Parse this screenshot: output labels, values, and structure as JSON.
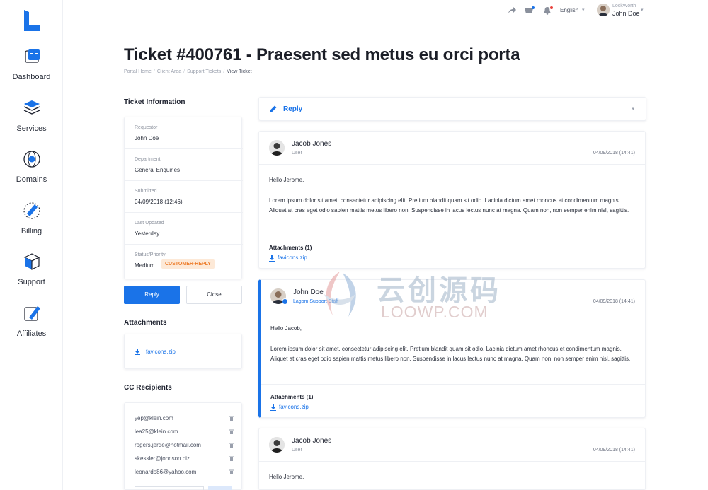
{
  "nav": {
    "items": [
      {
        "label": "Dashboard",
        "icon": "dashboard-icon"
      },
      {
        "label": "Services",
        "icon": "services-box-icon"
      },
      {
        "label": "Domains",
        "icon": "globe-icon"
      },
      {
        "label": "Billing",
        "icon": "billing-icon"
      },
      {
        "label": "Support",
        "icon": "support-box-icon"
      },
      {
        "label": "Affiliates",
        "icon": "affiliates-icon"
      }
    ]
  },
  "topbar": {
    "language": "English",
    "company": "LockWorth",
    "user_name": "John Doe",
    "icons": [
      "share-icon",
      "cart-icon",
      "bell-icon"
    ],
    "notification_color": "#e8413c"
  },
  "page": {
    "title": "Ticket #400761 - Praesent sed metus eu orci porta",
    "breadcrumb": [
      "Portal Home",
      "Client Area",
      "Support Tickets",
      "View Ticket"
    ]
  },
  "ticket_info": {
    "heading": "Ticket Information",
    "rows": [
      {
        "label": "Requestor",
        "value": "John Doe"
      },
      {
        "label": "Department",
        "value": "General Enquiries"
      },
      {
        "label": "Submitted",
        "value": "04/09/2018 (12:46)"
      },
      {
        "label": "Last Updated",
        "value": "Yesterday"
      },
      {
        "label": "Status/Priority",
        "value": "Medium"
      }
    ],
    "status_badge": "CUSTOMER-REPLY",
    "reply_button": "Reply",
    "close_button": "Close"
  },
  "attachments": {
    "heading": "Attachments",
    "file": "favicons.zip"
  },
  "cc": {
    "heading": "CC Recipients",
    "emails": [
      "yep@klein.com",
      "lea25@klein.com",
      "rogers.jerde@hotmail.com",
      "skessler@johnson.biz",
      "leonardo86@yahoo.com"
    ]
  },
  "reply_bar": {
    "label": "Reply"
  },
  "messages": [
    {
      "name": "Jacob Jones",
      "role": "User",
      "date": "04/09/2018 (14:41)",
      "greeting": "Hello Jerome,",
      "text": "Lorem ipsum dolor sit amet, consectetur adipiscing elit. Pretium blandit quam sit odio. Lacinia dictum amet rhoncus et condimentum magnis. Aliquet at cras eget odio sapien mattis metus libero non. Suspendisse in lacus lectus nunc at magna. Quam non, non semper enim nisl, sagittis.",
      "attachments_label": "Attachments (1)",
      "file": "favicons.zip"
    },
    {
      "name": "John Doe",
      "role": "Lagom Support Staff",
      "date": "04/09/2018 (14:41)",
      "greeting": "Hello Jacob,",
      "text": "Lorem ipsum dolor sit amet, consectetur adipiscing elit. Pretium blandit quam sit odio. Lacinia dictum amet rhoncus et condimentum magnis. Aliquet at cras eget odio sapien mattis metus libero non. Suspendisse in lacus lectus nunc at magna. Quam non, non semper enim nisl, sagittis.",
      "attachments_label": "Attachments (1)",
      "file": "favicons.zip"
    },
    {
      "name": "Jacob Jones",
      "role": "User",
      "date": "04/09/2018 (14:41)",
      "greeting": "Hello Jerome,"
    }
  ],
  "watermark": {
    "cn": "云创源码",
    "en": "LOOWP.COM"
  },
  "colors": {
    "accent": "#1a73e8",
    "badge_bg": "#fde9d7",
    "badge_text": "#ed7d2b"
  }
}
